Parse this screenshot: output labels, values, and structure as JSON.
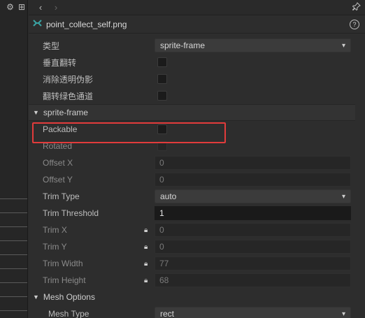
{
  "left_panel": {
    "icons": [
      "gear-icon",
      "layout-icon"
    ]
  },
  "topbar": {
    "back_glyph": "‹",
    "forward_glyph": "›",
    "pin_glyph": "⚲"
  },
  "file": {
    "name": "point_collect_self.png",
    "help_glyph": "?"
  },
  "texture_rows": [
    {
      "label": "类型",
      "type": "select",
      "value": "sprite-frame"
    },
    {
      "label": "垂直翻转",
      "type": "checkbox"
    },
    {
      "label": "消除透明伪影",
      "type": "checkbox"
    },
    {
      "label": "翻转绿色通道",
      "type": "checkbox"
    }
  ],
  "sprite_section": {
    "title": "sprite-frame",
    "rows": {
      "packable": {
        "label": "Packable"
      },
      "rotated": {
        "label": "Rotated"
      },
      "offset_x": {
        "label": "Offset X",
        "value": "0"
      },
      "offset_y": {
        "label": "Offset Y",
        "value": "0"
      },
      "trim_type": {
        "label": "Trim Type",
        "value": "auto"
      },
      "trim_threshold": {
        "label": "Trim Threshold",
        "value": "1"
      },
      "trim_x": {
        "label": "Trim X",
        "value": "0"
      },
      "trim_y": {
        "label": "Trim Y",
        "value": "0"
      },
      "trim_width": {
        "label": "Trim Width",
        "value": "77"
      },
      "trim_height": {
        "label": "Trim Height",
        "value": "68"
      }
    }
  },
  "mesh_section": {
    "title": "Mesh Options",
    "mesh_type": {
      "label": "Mesh Type",
      "value": "rect"
    }
  },
  "colors": {
    "highlight": "#e23b3b",
    "file_icon": "#3aa5a5"
  }
}
